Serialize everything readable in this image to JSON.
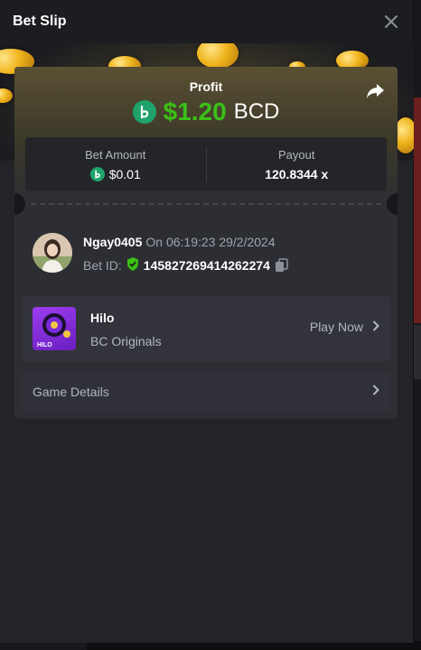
{
  "header": {
    "title": "Bet Slip",
    "close_icon": "close-icon"
  },
  "profit": {
    "label": "Profit",
    "amount": "$1.20",
    "currency": "BCD",
    "amount_color": "#3bc117",
    "share_icon": "share-icon"
  },
  "stats": {
    "bet_amount_label": "Bet Amount",
    "bet_amount_value": "$0.01",
    "payout_label": "Payout",
    "payout_value": "120.8344 x"
  },
  "user": {
    "name": "Ngay0405",
    "time": "On 06:19:23 29/2/2024",
    "bet_id_label": "Bet ID:",
    "bet_id": "145827269414262274"
  },
  "game": {
    "name": "Hilo",
    "provider": "BC Originals",
    "play_label": "Play Now",
    "thumb_text": "HILO"
  },
  "details": {
    "label": "Game Details"
  },
  "colors": {
    "brand_green": "#1fa36a",
    "panel": "#2d2e34",
    "background": "#17181b"
  }
}
